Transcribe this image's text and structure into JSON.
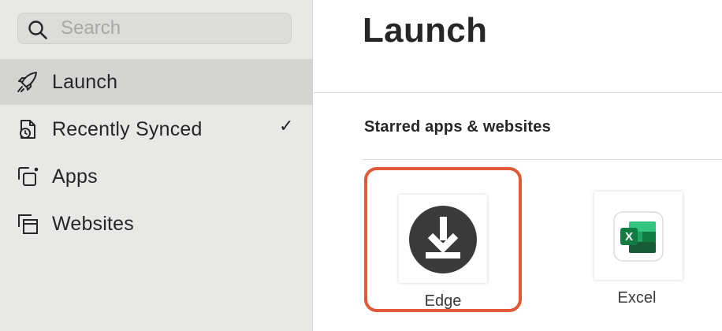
{
  "search": {
    "placeholder": "Search",
    "value": ""
  },
  "sidebar": {
    "items": [
      {
        "label": "Launch",
        "icon": "rocket-icon",
        "selected": true
      },
      {
        "label": "Recently Synced",
        "icon": "clock-document-icon",
        "checked": true
      },
      {
        "label": "Apps",
        "icon": "apps-icon"
      },
      {
        "label": "Websites",
        "icon": "websites-icon"
      }
    ],
    "check_glyph": "✓"
  },
  "main": {
    "title": "Launch",
    "section_title": "Starred apps & websites",
    "apps": [
      {
        "label": "Edge",
        "icon": "download-icon",
        "highlighted": true
      },
      {
        "label": "Excel",
        "icon": "excel-icon",
        "highlighted": false
      }
    ]
  },
  "colors": {
    "sidebar_bg": "#e8e8e7",
    "selected_bg": "#d4d4d3",
    "highlight": "#e05a38",
    "excel_green": "#1d6f42"
  }
}
